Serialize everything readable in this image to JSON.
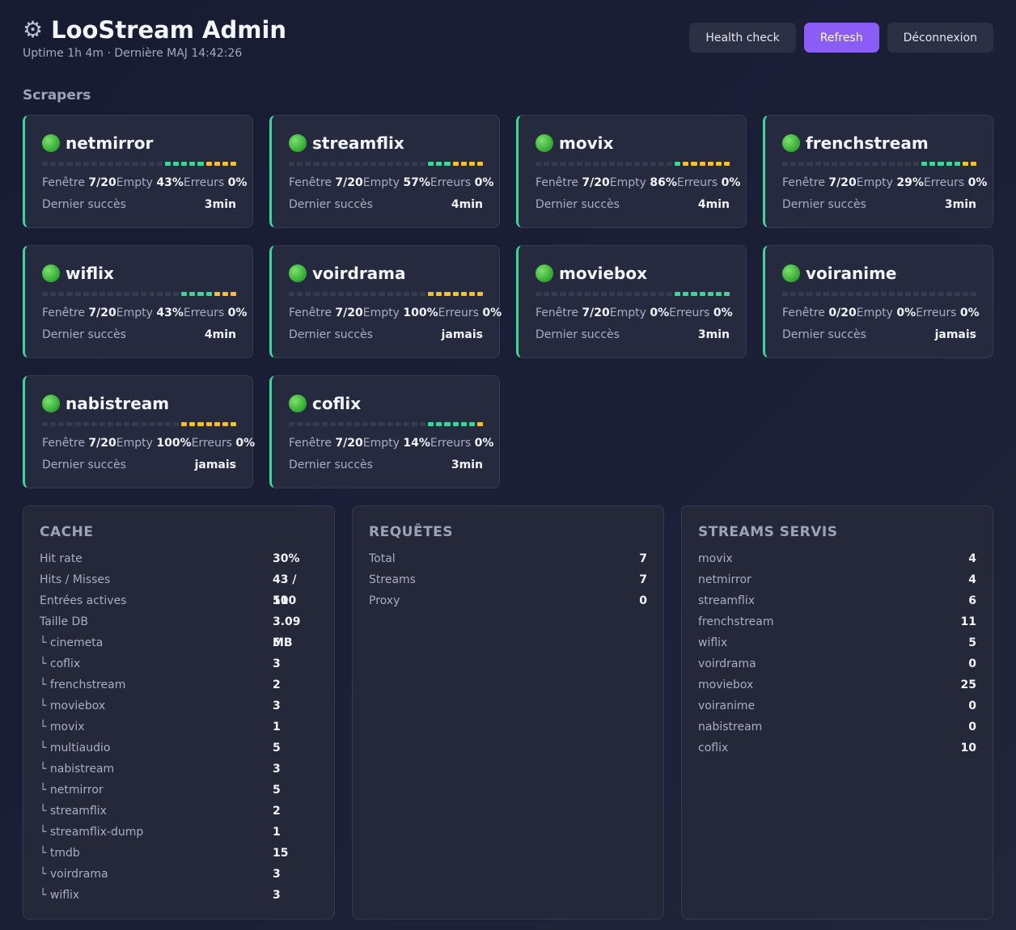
{
  "header": {
    "title": "LooStream Admin",
    "subtitle": "Uptime 1h 4m · Dernière MAJ 14:42:26",
    "buttons": {
      "health": "Health check",
      "refresh": "Refresh",
      "logout": "Déconnexion"
    }
  },
  "scrapers_title": "Scrapers",
  "labels": {
    "window": "Fenêtre",
    "empty": "Empty",
    "errors": "Erreurs",
    "last_success": "Dernier succès"
  },
  "scrapers": [
    {
      "name": "netmirror",
      "window": "7/20",
      "empty": "43%",
      "errors": "0%",
      "last": "3min",
      "bar": "gggggyyyy"
    },
    {
      "name": "streamflix",
      "window": "7/20",
      "empty": "57%",
      "errors": "0%",
      "last": "4min",
      "bar": "gggyyyy"
    },
    {
      "name": "movix",
      "window": "7/20",
      "empty": "86%",
      "errors": "0%",
      "last": "4min",
      "bar": "gyyyyyy"
    },
    {
      "name": "frenchstream",
      "window": "7/20",
      "empty": "29%",
      "errors": "0%",
      "last": "3min",
      "bar": "gggggyy"
    },
    {
      "name": "wiflix",
      "window": "7/20",
      "empty": "43%",
      "errors": "0%",
      "last": "4min",
      "bar": "ggggyyy"
    },
    {
      "name": "voirdrama",
      "window": "7/20",
      "empty": "100%",
      "errors": "0%",
      "last": "jamais",
      "bar": "yyyyyyy"
    },
    {
      "name": "moviebox",
      "window": "7/20",
      "empty": "0%",
      "errors": "0%",
      "last": "3min",
      "bar": "ggggggg"
    },
    {
      "name": "voiranime",
      "window": "0/20",
      "empty": "0%",
      "errors": "0%",
      "last": "jamais",
      "bar": ""
    },
    {
      "name": "nabistream",
      "window": "7/20",
      "empty": "100%",
      "errors": "0%",
      "last": "jamais",
      "bar": "yyyyyyy"
    },
    {
      "name": "coflix",
      "window": "7/20",
      "empty": "14%",
      "errors": "0%",
      "last": "3min",
      "bar": "ggggggy"
    }
  ],
  "cache": {
    "title": "CACHE",
    "rows": [
      {
        "label": "Hit rate",
        "value": "30%"
      },
      {
        "label": "Hits / Misses",
        "value": "43 / 100"
      },
      {
        "label": "Entrées actives",
        "value": "51"
      },
      {
        "label": "Taille DB",
        "value": "3.09 MB"
      },
      {
        "label": "└ cinemeta",
        "value": "5"
      },
      {
        "label": "└ coflix",
        "value": "3"
      },
      {
        "label": "└ frenchstream",
        "value": "2"
      },
      {
        "label": "└ moviebox",
        "value": "3"
      },
      {
        "label": "└ movix",
        "value": "1"
      },
      {
        "label": "└ multiaudio",
        "value": "5"
      },
      {
        "label": "└ nabistream",
        "value": "3"
      },
      {
        "label": "└ netmirror",
        "value": "5"
      },
      {
        "label": "└ streamflix",
        "value": "2"
      },
      {
        "label": "└ streamflix-dump",
        "value": "1"
      },
      {
        "label": "└ tmdb",
        "value": "15"
      },
      {
        "label": "└ voirdrama",
        "value": "3"
      },
      {
        "label": "└ wiflix",
        "value": "3"
      }
    ]
  },
  "requests": {
    "title": "REQUÊTES",
    "rows": [
      {
        "label": "Total",
        "value": "7"
      },
      {
        "label": "Streams",
        "value": "7"
      },
      {
        "label": "Proxy",
        "value": "0"
      }
    ]
  },
  "streams": {
    "title": "STREAMS SERVIS",
    "rows": [
      {
        "label": "movix",
        "value": "4"
      },
      {
        "label": "netmirror",
        "value": "4"
      },
      {
        "label": "streamflix",
        "value": "6"
      },
      {
        "label": "frenchstream",
        "value": "11"
      },
      {
        "label": "wiflix",
        "value": "5"
      },
      {
        "label": "voirdrama",
        "value": "0"
      },
      {
        "label": "moviebox",
        "value": "25"
      },
      {
        "label": "voiranime",
        "value": "0"
      },
      {
        "label": "nabistream",
        "value": "0"
      },
      {
        "label": "coflix",
        "value": "10"
      }
    ]
  },
  "colors": {
    "ok": "#3ed598",
    "empty": "#f4c02d",
    "accent": "#8b5cf6"
  },
  "icons": {
    "title": "gear-icon",
    "status": "green-circle-icon"
  }
}
